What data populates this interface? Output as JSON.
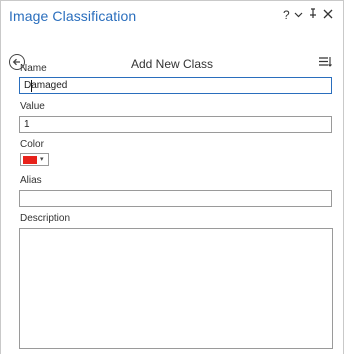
{
  "pane": {
    "title": "Image Classification",
    "controls": {
      "help": "?",
      "menu": "⌄",
      "pin": "⊥",
      "close": "✕"
    }
  },
  "subheader": {
    "title": "Add New Class",
    "back_icon": "back-arrow-icon",
    "menu_icon": "options-menu-icon"
  },
  "form": {
    "name_label": "Name",
    "name_value": "Damaged",
    "value_label": "Value",
    "value_value": "1",
    "color_label": "Color",
    "color_value": "#e8221b",
    "alias_label": "Alias",
    "alias_value": "",
    "description_label": "Description",
    "description_value": ""
  },
  "colors": {
    "title": "#2a6ebd",
    "focus_border": "#2a6ebd",
    "swatch": "#e8221b"
  }
}
